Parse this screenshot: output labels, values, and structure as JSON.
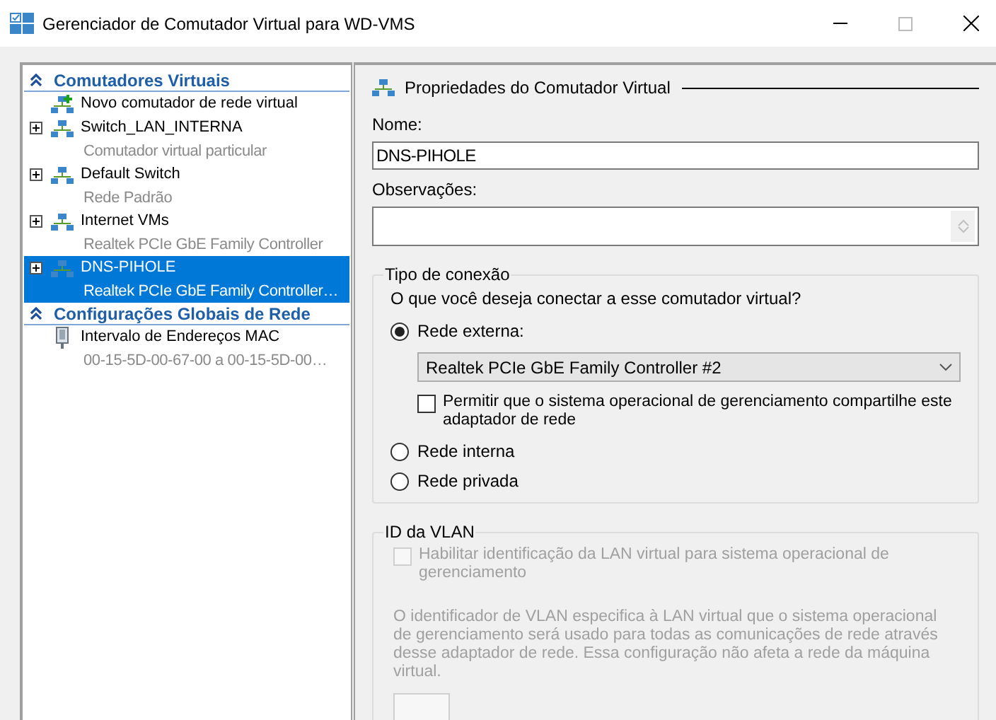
{
  "window": {
    "title": "Gerenciador de Comutador Virtual para WD-VMS"
  },
  "sidebar": {
    "sections": [
      {
        "title": "Comutadores Virtuais",
        "expanded": true,
        "items": [
          {
            "kind": "new",
            "label": "Novo comutador de rede virtual",
            "selected": false
          },
          {
            "kind": "switch",
            "label": "Switch_LAN_INTERNA",
            "sublabel": "Comutador virtual particular",
            "expanded": false,
            "selected": false
          },
          {
            "kind": "switch",
            "label": "Default Switch",
            "sublabel": "Rede Padrão",
            "expanded": false,
            "selected": false
          },
          {
            "kind": "switch",
            "label": "Internet VMs",
            "sublabel": "Realtek PCIe GbE Family Controller",
            "expanded": false,
            "selected": false
          },
          {
            "kind": "switch",
            "label": "DNS-PIHOLE",
            "sublabel": "Realtek PCIe GbE Family Controller…",
            "expanded": false,
            "selected": true
          }
        ]
      },
      {
        "title": "Configurações Globais de Rede",
        "expanded": true,
        "items": [
          {
            "kind": "mac",
            "label": "Intervalo de Endereços MAC",
            "sublabel": "00-15-5D-00-67-00 a 00-15-5D-00…",
            "selected": false
          }
        ]
      }
    ]
  },
  "properties": {
    "title": "Propriedades do Comutador Virtual",
    "name_label": "Nome:",
    "name_value": "DNS-PIHOLE",
    "notes_label": "Observações:",
    "connection": {
      "legend": "Tipo de conexão",
      "question": "O que você deseja conectar a esse comutador virtual?",
      "options": [
        {
          "label": "Rede externa:",
          "selected": true
        },
        {
          "label": "Rede interna",
          "selected": false
        },
        {
          "label": "Rede privada",
          "selected": false
        }
      ],
      "adapter": "Realtek PCIe GbE Family Controller #2",
      "share": {
        "label": "Permitir que o sistema operacional de gerenciamento compartilhe este adaptador de rede",
        "checked": false
      }
    },
    "vlan": {
      "legend": "ID da VLAN",
      "disabled": true,
      "enable": {
        "label": "Habilitar identificação da LAN virtual para sistema operacional de gerenciamento",
        "checked": false
      },
      "description": "O identificador de VLAN especifica à LAN virtual que o sistema operacional de gerenciamento será usado para todas as comunicações de rede através desse adaptador de rede. Essa configuração não afeta a rede da máquina virtual."
    }
  }
}
